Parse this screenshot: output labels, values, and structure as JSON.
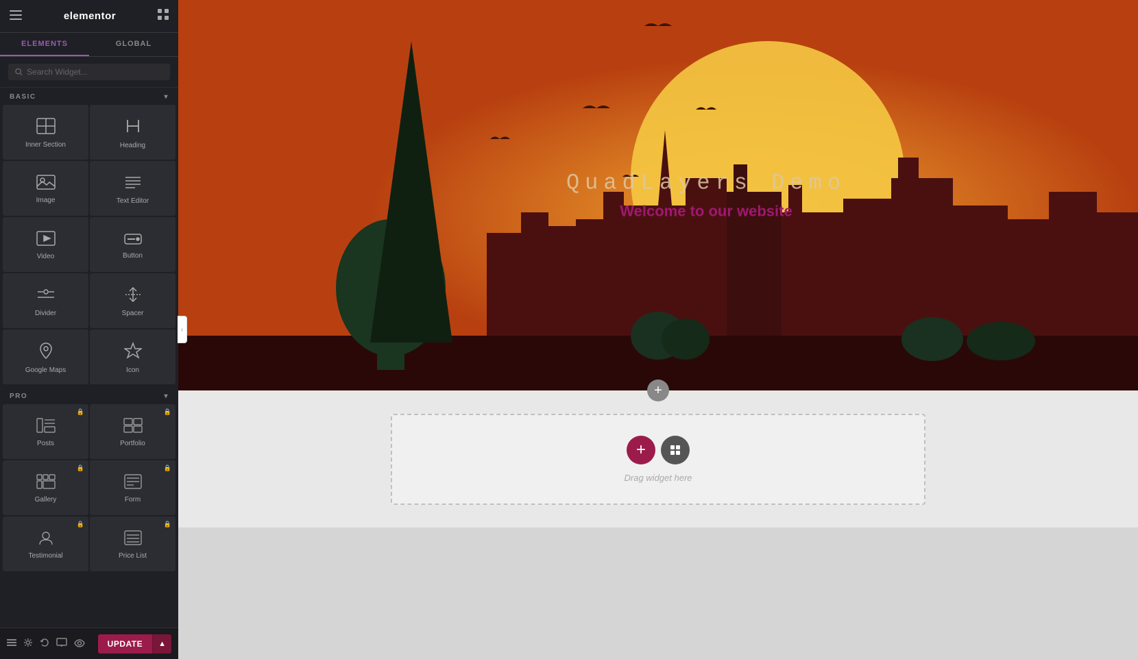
{
  "app": {
    "name": "elementor",
    "logo": "elementor"
  },
  "sidebar": {
    "tabs": [
      {
        "id": "elements",
        "label": "ELEMENTS",
        "active": true
      },
      {
        "id": "global",
        "label": "GLOBAL",
        "active": false
      }
    ],
    "search": {
      "placeholder": "Search Widget..."
    },
    "sections": [
      {
        "id": "basic",
        "label": "BASIC",
        "collapsed": false,
        "widgets": [
          {
            "id": "inner-section",
            "label": "Inner Section",
            "icon": "inner-section-icon",
            "locked": false
          },
          {
            "id": "heading",
            "label": "Heading",
            "icon": "heading-icon",
            "locked": false
          },
          {
            "id": "image",
            "label": "Image",
            "icon": "image-icon",
            "locked": false
          },
          {
            "id": "text-editor",
            "label": "Text Editor",
            "icon": "text-editor-icon",
            "locked": false
          },
          {
            "id": "video",
            "label": "Video",
            "icon": "video-icon",
            "locked": false
          },
          {
            "id": "button",
            "label": "Button",
            "icon": "button-icon",
            "locked": false
          },
          {
            "id": "divider",
            "label": "Divider",
            "icon": "divider-icon",
            "locked": false
          },
          {
            "id": "spacer",
            "label": "Spacer",
            "icon": "spacer-icon",
            "locked": false
          },
          {
            "id": "google-maps",
            "label": "Google Maps",
            "icon": "maps-icon",
            "locked": false
          },
          {
            "id": "icon",
            "label": "Icon",
            "icon": "icon-icon",
            "locked": false
          }
        ]
      },
      {
        "id": "pro",
        "label": "PRO",
        "collapsed": false,
        "widgets": [
          {
            "id": "posts",
            "label": "Posts",
            "icon": "posts-icon",
            "locked": true
          },
          {
            "id": "portfolio",
            "label": "Portfolio",
            "icon": "portfolio-icon",
            "locked": true
          },
          {
            "id": "gallery",
            "label": "Gallery",
            "icon": "gallery-icon",
            "locked": true
          },
          {
            "id": "form",
            "label": "Form",
            "icon": "form-icon",
            "locked": true
          },
          {
            "id": "testimonial-carousel",
            "label": "Testimonial",
            "icon": "testimonial-icon",
            "locked": true
          },
          {
            "id": "price-list",
            "label": "Price List",
            "icon": "pricelist-icon",
            "locked": true
          }
        ]
      }
    ],
    "footer": {
      "update_label": "UPDATE",
      "icons": [
        "history-icon",
        "desktop-icon",
        "eye-icon",
        "layers-icon",
        "settings-icon",
        "undo-icon"
      ]
    }
  },
  "canvas": {
    "hero": {
      "title": "QuadLayers Demo",
      "subtitle": "Welcome to our website"
    },
    "empty_section": {
      "add_label": "+",
      "drag_label": "Drag widget here"
    }
  },
  "colors": {
    "accent": "#9b1c4a",
    "sidebar_bg": "#1f2025",
    "widget_bg": "#2c2d33",
    "hero_bg": "#c0471a",
    "subtitle_color": "#a01870"
  }
}
